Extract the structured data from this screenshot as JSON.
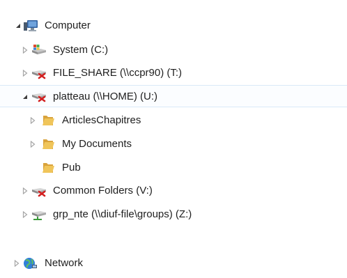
{
  "tree": {
    "items": [
      {
        "label": "Computer",
        "icon": "computer-icon",
        "expander": "expanded"
      },
      {
        "label": "System (C:)",
        "icon": "local-drive-icon",
        "expander": "collapsed"
      },
      {
        "label": "FILE_SHARE (\\\\ccpr90) (T:)",
        "icon": "disconnected-network-drive-icon",
        "expander": "collapsed"
      },
      {
        "label": "platteau (\\\\HOME) (U:)",
        "icon": "disconnected-network-drive-icon",
        "expander": "expanded",
        "selected": true
      },
      {
        "label": "ArticlesChapitres",
        "icon": "folder-icon",
        "expander": "collapsed"
      },
      {
        "label": "My Documents",
        "icon": "folder-icon",
        "expander": "collapsed"
      },
      {
        "label": "Pub",
        "icon": "folder-icon",
        "expander": "none"
      },
      {
        "label": "Common Folders (V:)",
        "icon": "disconnected-network-drive-icon",
        "expander": "collapsed"
      },
      {
        "label": "grp_nte (\\\\diuf-file\\groups) (Z:)",
        "icon": "network-drive-icon",
        "expander": "collapsed"
      },
      {
        "label": "Network",
        "icon": "network-icon",
        "expander": "collapsed"
      }
    ]
  },
  "colors": {
    "selection_border": "#d9e9f8",
    "folder": "#e7b84a",
    "collapsed_arrow": "#a6a6a6",
    "expanded_arrow": "#3c3c3c"
  }
}
